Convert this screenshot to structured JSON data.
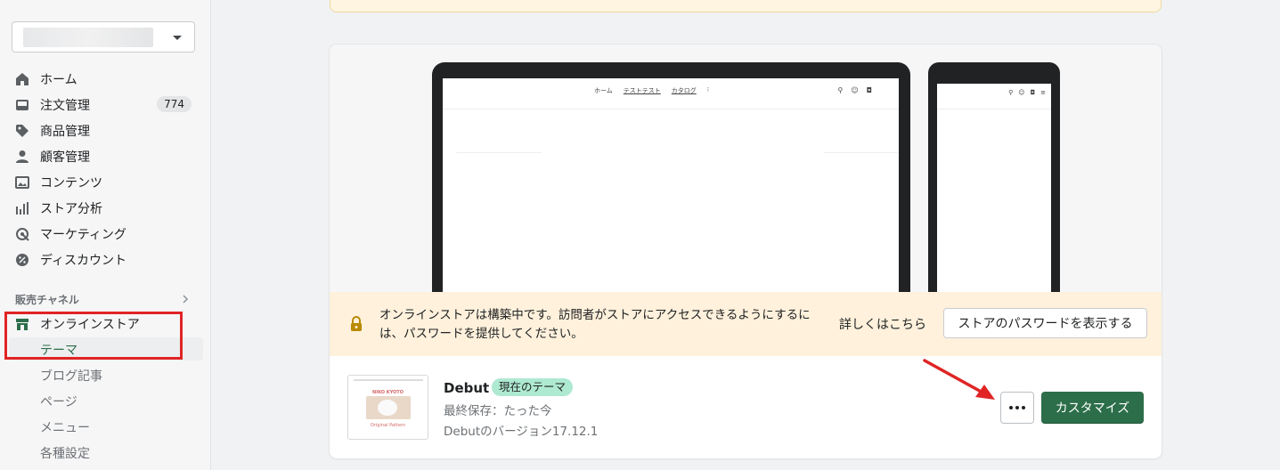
{
  "sidebar": {
    "store_select": "",
    "nav": [
      {
        "label": "ホーム",
        "icon": "home-icon"
      },
      {
        "label": "注文管理",
        "icon": "inbox-icon",
        "badge": "774"
      },
      {
        "label": "商品管理",
        "icon": "tag-icon"
      },
      {
        "label": "顧客管理",
        "icon": "person-icon"
      },
      {
        "label": "コンテンツ",
        "icon": "image-icon"
      },
      {
        "label": "ストア分析",
        "icon": "bar-chart-icon"
      },
      {
        "label": "マーケティング",
        "icon": "target-icon"
      },
      {
        "label": "ディスカウント",
        "icon": "discount-icon"
      }
    ],
    "section_label": "販売チャネル",
    "online_store": {
      "label": "オンラインストア",
      "icon": "store-icon"
    },
    "sub_items": [
      "テーマ",
      "ブログ記事",
      "ページ",
      "メニュー",
      "各種設定"
    ]
  },
  "preview": {
    "desktop_nav": [
      "ホーム",
      "テストテスト",
      "カタログ"
    ],
    "icons": [
      "search-icon",
      "account-icon",
      "cart-icon",
      "menu-icon"
    ]
  },
  "notice": {
    "text": "オンラインストアは構築中です。訪問者がストアにアクセスできるようにするには、パスワードを提供してください。",
    "link": "詳しくはこちら",
    "button": "ストアのパスワードを表示する"
  },
  "theme": {
    "name": "Debut",
    "badge": "現在のテーマ",
    "saved": "最終保存：たった今",
    "version": "Debutのバージョン17.12.1",
    "customize": "カスタマイズ",
    "thumb_title": "NIKO KYOTO",
    "thumb_sub": "Original Pattern"
  },
  "colors": {
    "primary": "#2c6e49",
    "badge_green": "#aee9d1",
    "notice_bg": "#fff1dc",
    "annotation_red": "#e02424"
  }
}
